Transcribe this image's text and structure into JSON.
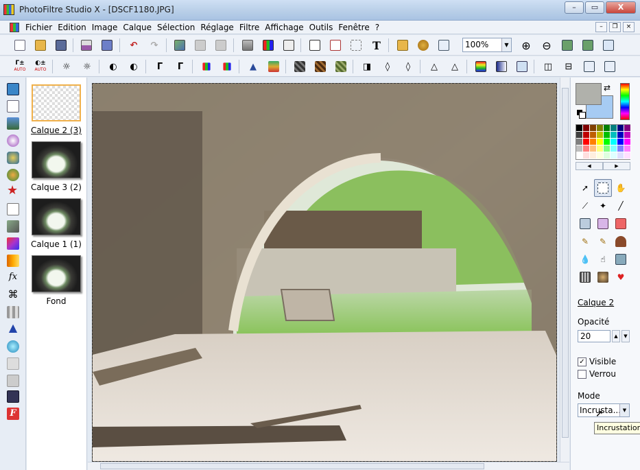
{
  "window": {
    "title": "PhotoFiltre Studio X - [DSCF1180.JPG]",
    "min_label": "–",
    "max_label": "▭",
    "close_label": "X"
  },
  "menu": {
    "items": [
      "Fichier",
      "Edition",
      "Image",
      "Calque",
      "Sélection",
      "Réglage",
      "Filtre",
      "Affichage",
      "Outils",
      "Fenêtre",
      "?"
    ],
    "mdi_min": "–",
    "mdi_restore": "❐",
    "mdi_close": "×"
  },
  "toolbar": {
    "zoom_value": "100%",
    "text_tool_label": "T",
    "auto_label": "AUTO"
  },
  "layers": [
    {
      "label": "Calque 2 (3)",
      "selected": true,
      "empty": true
    },
    {
      "label": "Calque 3 (2)",
      "selected": false,
      "empty": false
    },
    {
      "label": "Calque 1 (1)",
      "selected": false,
      "empty": false
    },
    {
      "label": "Fond",
      "selected": false,
      "empty": false
    }
  ],
  "colors": {
    "foreground": "#b0b1ab",
    "background": "#a6cbf3"
  },
  "palette": [
    "#000000",
    "#7f0000",
    "#7f3f00",
    "#7f7f00",
    "#007f00",
    "#007f7f",
    "#00007f",
    "#7f007f",
    "#3f3f3f",
    "#bf0000",
    "#bf5f00",
    "#bfbf00",
    "#00bf00",
    "#00bfbf",
    "#0000bf",
    "#bf00bf",
    "#7f7f7f",
    "#ff0000",
    "#ff8000",
    "#ffff00",
    "#00ff00",
    "#00ffff",
    "#0000ff",
    "#ff00ff",
    "#bfbfbf",
    "#ff7f7f",
    "#ffbf7f",
    "#ffff7f",
    "#7fff7f",
    "#7fffff",
    "#7f7fff",
    "#ff7fff",
    "#ffffff",
    "#ffdfdf",
    "#ffefdf",
    "#ffffdf",
    "#dfffdf",
    "#dfffff",
    "#dfdfff",
    "#ffdfff"
  ],
  "properties": {
    "layer_name": "Calque 2",
    "opacity_label": "Opacité",
    "opacity_value": "20",
    "visible_label": "Visible",
    "visible_checked": "✓",
    "lock_label": "Verrou",
    "mode_label": "Mode",
    "mode_value": "Incrusta...",
    "tooltip": "Incrustation"
  }
}
